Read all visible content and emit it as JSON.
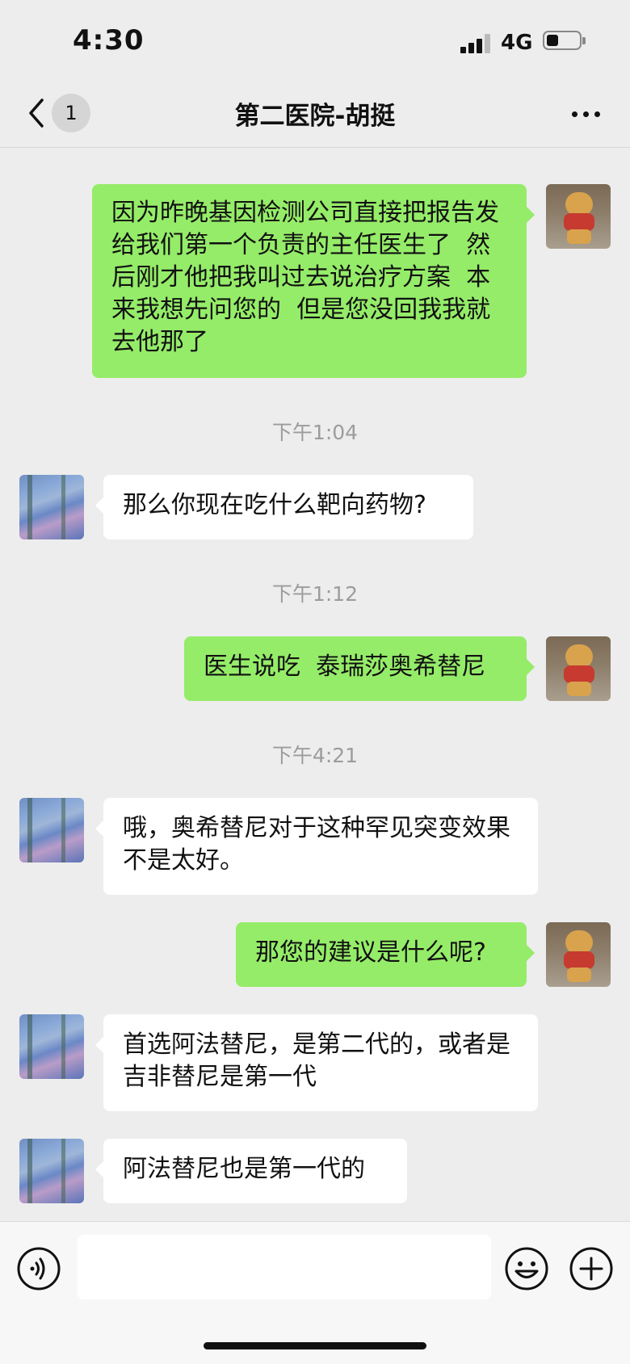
{
  "status_bar": {
    "time": "4:30",
    "network": "4G"
  },
  "nav": {
    "unread_count": "1",
    "title": "第二医院-胡挺"
  },
  "messages": [
    {
      "side": "out",
      "text": "因为昨晚基因检测公司直接把报告发给我们第一个负责的主任医生了  然后刚才他把我叫过去说治疗方案  本来我想先问您的  但是您没回我我就去他那了"
    },
    {
      "timestamp": "下午1:04"
    },
    {
      "side": "in",
      "text": "那么你现在吃什么靶向药物?"
    },
    {
      "timestamp": "下午1:12"
    },
    {
      "side": "out",
      "text": "医生说吃  泰瑞莎奥希替尼"
    },
    {
      "timestamp": "下午4:21"
    },
    {
      "side": "in",
      "text": "哦，奥希替尼对于这种罕见突变效果不是太好。"
    },
    {
      "side": "out",
      "text": "那您的建议是什么呢?"
    },
    {
      "side": "in",
      "text": "首选阿法替尼，是第二代的，或者是吉非替尼是第一代"
    },
    {
      "side": "in",
      "text": "阿法替尼也是第一代的"
    }
  ],
  "input": {
    "placeholder": ""
  },
  "icons": {
    "back": "chevron-left-icon",
    "more": "more-dots-icon",
    "voice": "voice-icon",
    "emoji": "emoji-icon",
    "plus": "plus-icon"
  },
  "colors": {
    "outgoing_bubble": "#95ec69",
    "incoming_bubble": "#ffffff",
    "background": "#ededed"
  }
}
